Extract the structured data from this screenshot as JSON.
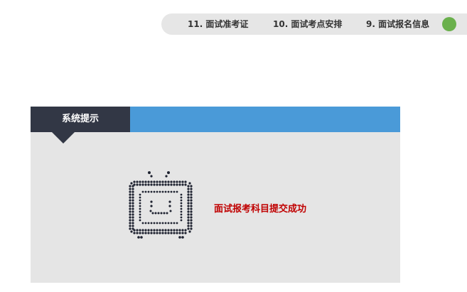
{
  "steps": {
    "items": [
      {
        "label": "11. 面试准考证"
      },
      {
        "label": "10. 面试考点安排"
      },
      {
        "label": "9. 面试报名信息"
      }
    ],
    "active_color": "#6ab04c"
  },
  "panel": {
    "tab_label": "系统提示",
    "tab_color": "#323745",
    "header_color": "#4a9ad8",
    "icon": "tv-dotted-icon",
    "message": "面试报考科目提交成功",
    "message_color": "#c00000"
  }
}
